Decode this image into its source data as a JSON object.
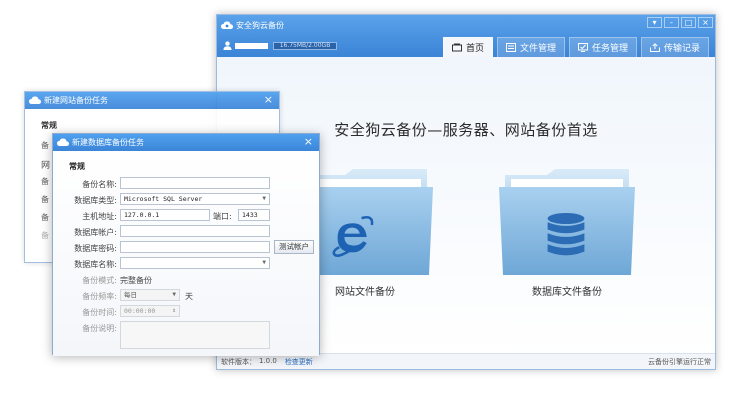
{
  "main_window": {
    "title": "安全狗云备份",
    "controls": [
      "▾",
      "-",
      "□",
      "×"
    ],
    "quota": "16.75MB/2.00GB",
    "tabs": [
      {
        "label": "首页",
        "icon": "home-icon",
        "active": true
      },
      {
        "label": "文件管理",
        "icon": "file-manage-icon",
        "active": false
      },
      {
        "label": "任务管理",
        "icon": "task-manage-icon",
        "active": false
      },
      {
        "label": "传输记录",
        "icon": "transfer-log-icon",
        "active": false
      }
    ],
    "headline": "安全狗云备份—服务器、网站备份首选",
    "cards": [
      {
        "label": "网站文件备份",
        "icon": "internet-explorer-icon"
      },
      {
        "label": "数据库文件备份",
        "icon": "database-icon"
      }
    ],
    "status": {
      "version_label": "软件版本：",
      "version": "1.0.0",
      "check_update": "检查更新",
      "engine_status": "云备份引擎运行正常"
    },
    "colors": {
      "titlebar": "#3b84d6",
      "link": "#2a6fc9",
      "folder": "#8fbde4"
    }
  },
  "web_dialog": {
    "title": "新建网站备份任务",
    "section": "常规",
    "labels": [
      "备",
      "网",
      "备",
      "备",
      "备",
      "备"
    ]
  },
  "db_dialog": {
    "title": "新建数据库备份任务",
    "section": "常规",
    "name_label": "备份名称:",
    "name_value": "",
    "db_type_label": "数据库类型:",
    "db_type_value": "Microsoft SQL Server",
    "host_label": "主机地址:",
    "host_value": "127.0.0.1",
    "port_label": "端口:",
    "port_value": "1433",
    "account_label": "数据库帐户:",
    "account_value": "",
    "password_label": "数据库密码:",
    "password_value": "",
    "test_button": "测试帐户",
    "dbname_label": "数据库名称:",
    "dbname_value": "",
    "mode_label": "备份模式:",
    "mode_value": "完整备份",
    "freq_label": "备份频率:",
    "freq_value": "每日",
    "freq_unit": "天",
    "time_label": "备份时间:",
    "time_value": "00:00:00",
    "desc_label": "备份说明:"
  }
}
